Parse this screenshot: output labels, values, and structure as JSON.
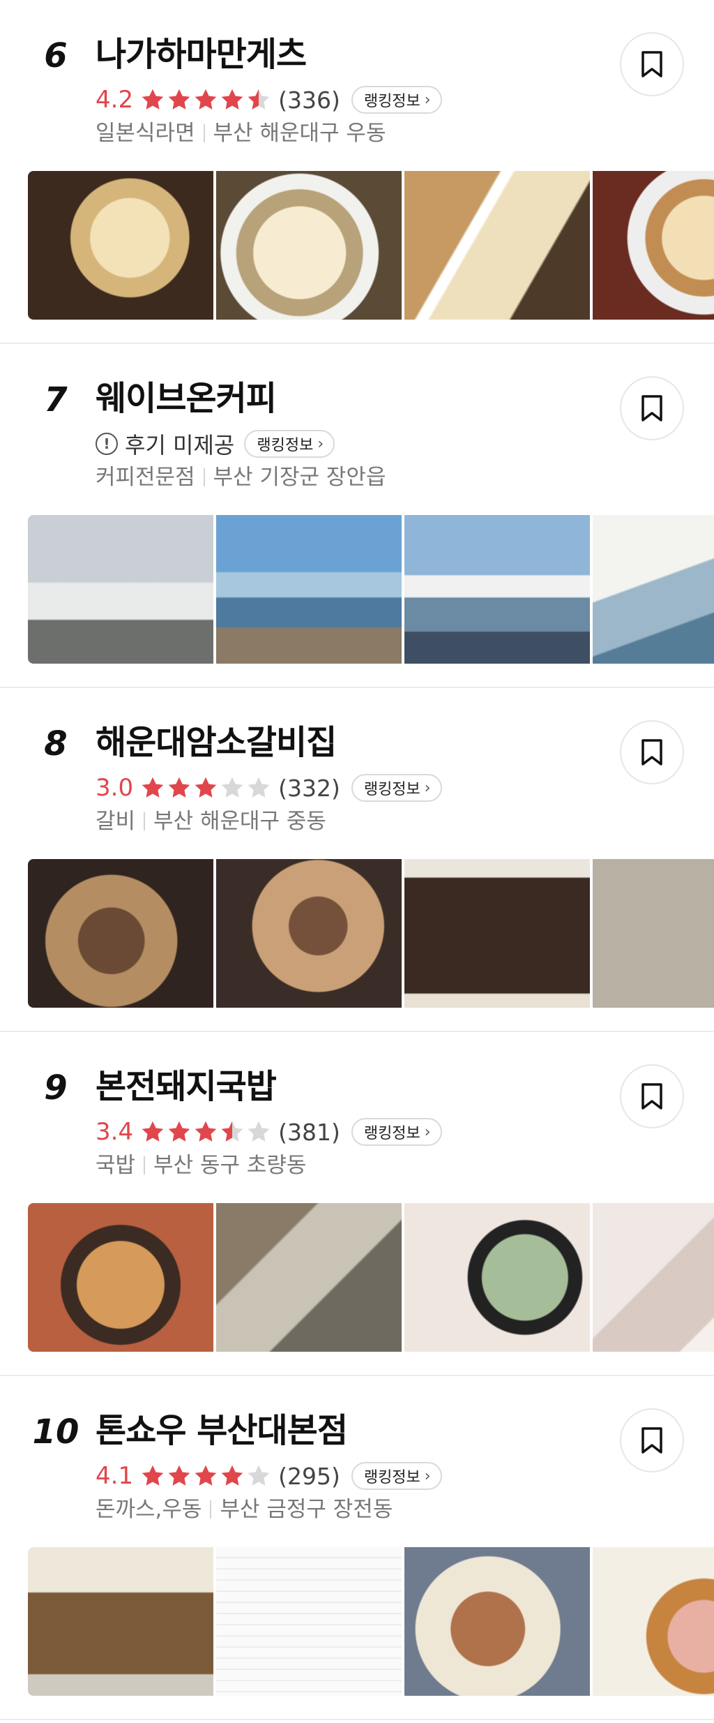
{
  "colors": {
    "accent_red": "#e0464b",
    "star_filled": "#e0464b",
    "star_empty": "#d8d8d8",
    "meta_gray": "#777777"
  },
  "icons": {
    "bookmark": "bookmark-icon",
    "star": "star-icon",
    "info": "info-icon",
    "chevron": "chevron-right-icon"
  },
  "restaurants": [
    {
      "rank": "6",
      "name": "나가하마만게츠",
      "rating": "4.2",
      "stars_value": 4.5,
      "review_count": "(336)",
      "rank_info_label": "랭킹정보",
      "category": "일본식라면",
      "location": "부산 해운대구 우동",
      "photos": [
        "ramen-photo",
        "ramen-photo",
        "ramen-photo",
        "ramen-photo"
      ]
    },
    {
      "rank": "7",
      "name": "웨이브온커피",
      "no_review_text": "후기 미제공",
      "rank_info_label": "랭킹정보",
      "category": "커피전문점",
      "location": "부산 기장군 장안읍",
      "photos": [
        "cafe-photo",
        "cafe-photo",
        "cafe-photo",
        "cafe-photo"
      ]
    },
    {
      "rank": "8",
      "name": "해운대암소갈비집",
      "rating": "3.0",
      "stars_value": 3,
      "review_count": "(332)",
      "rank_info_label": "랭킹정보",
      "category": "갈비",
      "location": "부산 해운대구 중동",
      "photos": [
        "galbi-photo",
        "galbi-photo",
        "menu-board-photo",
        "wall-menu-photo"
      ]
    },
    {
      "rank": "9",
      "name": "본전돼지국밥",
      "rating": "3.4",
      "stars_value": 3.5,
      "review_count": "(381)",
      "rank_info_label": "랭킹정보",
      "category": "국밥",
      "location": "부산 동구 초량동",
      "photos": [
        "gukbap-photo",
        "gukbap-photo",
        "gukbap-photo",
        "pork-photo"
      ]
    },
    {
      "rank": "10",
      "name": "톤쇼우 부산대본점",
      "rating": "4.1",
      "stars_value": 4,
      "review_count": "(295)",
      "rank_info_label": "랭킹정보",
      "category": "돈까스,우동",
      "location": "부산 금정구 장전동",
      "photos": [
        "storefront-photo",
        "menu-photo",
        "tonkatsu-photo",
        "tonkatsu-photo"
      ]
    }
  ]
}
